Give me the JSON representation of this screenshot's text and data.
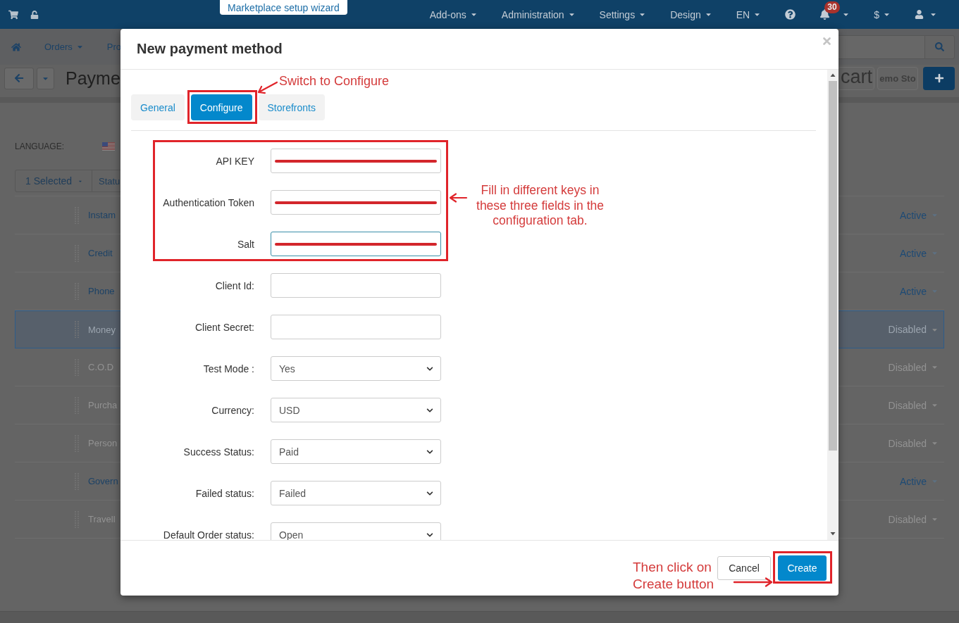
{
  "top_bar": {
    "wizard_button": "Marketplace setup wizard",
    "menus": [
      {
        "label": "Add-ons"
      },
      {
        "label": "Administration"
      },
      {
        "label": "Settings"
      },
      {
        "label": "Design"
      },
      {
        "label": "EN"
      }
    ],
    "notifications_badge": "30",
    "currency_menu": "$"
  },
  "nav": {
    "items": [
      {
        "label": "Orders",
        "dropdown": true
      },
      {
        "label": "Pro",
        "dropdown": false
      }
    ]
  },
  "page_header": {
    "title": "Payme",
    "storefront_logo_text": "cart",
    "storefront_button": "emo Sto"
  },
  "language": {
    "label": "LANGUAGE:"
  },
  "bulk_actions": {
    "selected_button": "1 Selected",
    "status_button": "Statu"
  },
  "methods": [
    {
      "name": "Instam",
      "status": "Active",
      "enabled": true,
      "selected": false
    },
    {
      "name": "Credit",
      "status": "Active",
      "enabled": true,
      "selected": false
    },
    {
      "name": "Phone",
      "status": "Active",
      "enabled": true,
      "selected": false
    },
    {
      "name": "Money",
      "status": "Disabled",
      "enabled": false,
      "selected": true
    },
    {
      "name": "C.O.D",
      "status": "Disabled",
      "enabled": false,
      "selected": false
    },
    {
      "name": "Purcha",
      "status": "Disabled",
      "enabled": false,
      "selected": false
    },
    {
      "name": "Person",
      "status": "Disabled",
      "enabled": false,
      "selected": false
    },
    {
      "name": "Govern",
      "status": "Active",
      "enabled": true,
      "selected": false
    },
    {
      "name": "Travell",
      "status": "Disabled",
      "enabled": false,
      "selected": false
    }
  ],
  "modal": {
    "title": "New payment method",
    "tabs": [
      {
        "label": "General",
        "selected": false
      },
      {
        "label": "Configure",
        "selected": true
      },
      {
        "label": "Storefronts",
        "selected": false
      }
    ],
    "fields": [
      {
        "kind": "text",
        "label": "API KEY",
        "redacted": true,
        "focused": false
      },
      {
        "kind": "text",
        "label": "Authentication Token",
        "redacted": true,
        "focused": false
      },
      {
        "kind": "text",
        "label": "Salt",
        "redacted": true,
        "focused": true
      },
      {
        "kind": "text",
        "label": "Client Id:",
        "redacted": false,
        "focused": false
      },
      {
        "kind": "text",
        "label": "Client Secret:",
        "redacted": false,
        "focused": false
      },
      {
        "kind": "select",
        "label": "Test Mode :",
        "value": "Yes",
        "focused": false
      },
      {
        "kind": "select",
        "label": "Currency:",
        "value": "USD",
        "focused": false
      },
      {
        "kind": "select",
        "label": "Success Status:",
        "value": "Paid",
        "focused": false
      },
      {
        "kind": "select",
        "label": "Failed status:",
        "value": "Failed",
        "focused": false
      },
      {
        "kind": "select",
        "label": "Default Order status:",
        "value": "Open",
        "focused": false
      }
    ],
    "buttons": [
      {
        "label": "Cancel",
        "kind": "secondary"
      },
      {
        "label": "Create",
        "kind": "primary"
      }
    ]
  },
  "annotations": [
    {
      "lines": [
        "Switch to Configure"
      ]
    },
    {
      "lines": [
        "Fill in different keys in",
        "these three fields in the",
        "configuration tab."
      ]
    },
    {
      "lines": [
        "Then click on",
        "Create button"
      ]
    }
  ]
}
